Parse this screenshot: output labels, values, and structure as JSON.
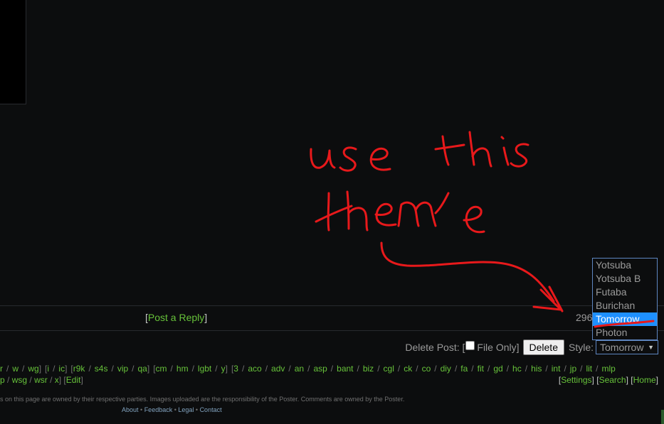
{
  "reply_bar": {
    "post_reply_label": "Post a Reply",
    "stats_partial": "296"
  },
  "delete_form": {
    "delete_post_label": "Delete Post: [",
    "file_only_label": "File Only]",
    "delete_button": "Delete",
    "style_label": "Style:",
    "style_selected": "Tomorrow"
  },
  "style_options": [
    "Yotsuba",
    "Yotsuba B",
    "Futaba",
    "Burichan",
    "Tomorrow",
    "Photon"
  ],
  "board_groups": [
    {
      "boards": [
        "r",
        "w",
        "wg"
      ],
      "cut_left": true
    },
    {
      "boards": [
        "i",
        "ic"
      ]
    },
    {
      "boards": [
        "r9k",
        "s4s",
        "vip",
        "qa"
      ]
    },
    {
      "boards": [
        "cm",
        "hm",
        "lgbt",
        "y"
      ]
    },
    {
      "boards": [
        "3",
        "aco",
        "adv",
        "an",
        "asp",
        "bant",
        "biz",
        "cgl",
        "ck",
        "co",
        "diy",
        "fa",
        "fit",
        "gd",
        "hc",
        "his",
        "int",
        "jp",
        "lit",
        "mlp"
      ],
      "open": true
    }
  ],
  "edit_row": {
    "boards": [
      "p",
      "wsg",
      "wsr",
      "x"
    ],
    "edit_label": "Edit"
  },
  "nav_links": [
    "Settings",
    "Search",
    "Home"
  ],
  "footer": {
    "copyright": "s on this page are owned by their respective parties. Images uploaded are the responsibility of the Poster. Comments are owned by the Poster.",
    "links": [
      "About",
      "Feedback",
      "Legal",
      "Contact"
    ]
  },
  "annotation": {
    "text": "use this theme",
    "ink_color": "#e8191b"
  },
  "colors": {
    "background": "#0c0d0e",
    "link_green": "#67c23a",
    "link_blue": "#81a2be",
    "selection": "#1e90ff"
  }
}
